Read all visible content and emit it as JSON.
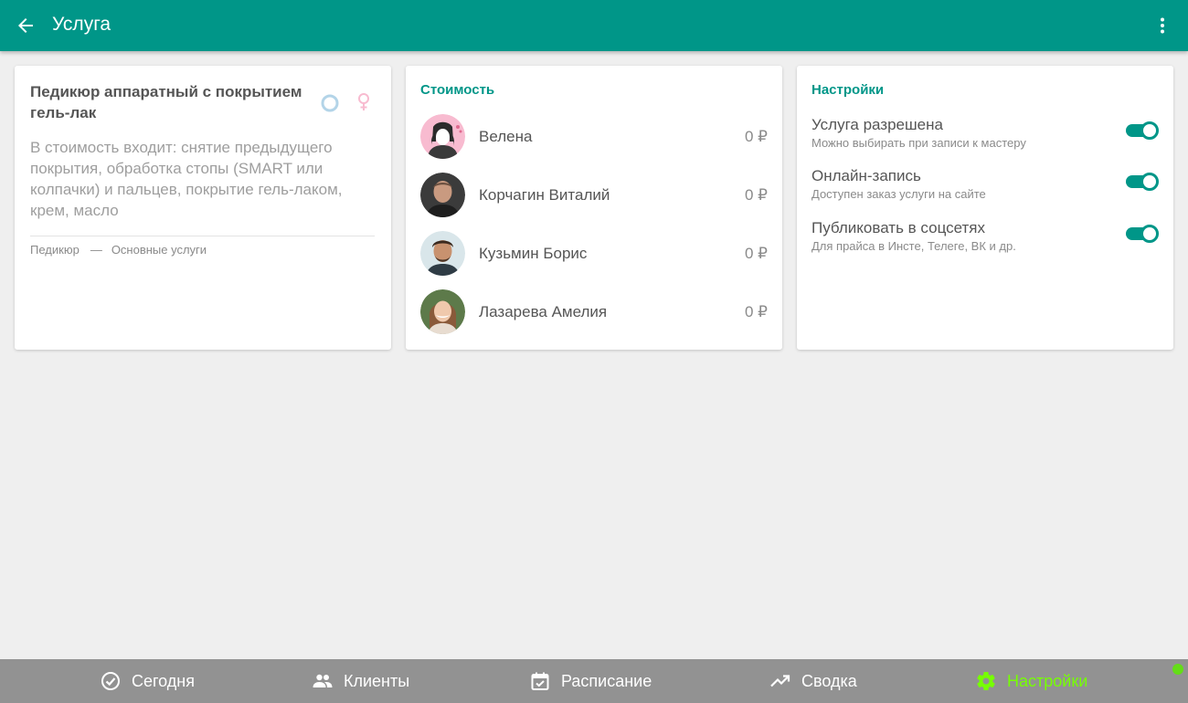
{
  "appbar": {
    "title": "Услуга",
    "back_icon": "arrow-left-icon",
    "menu_icon": "more-vert-icon",
    "color": "#009688"
  },
  "service": {
    "title": "Педикюр аппаратный с покрытием гель-лак",
    "description": "В стоимость входит: снятие предыдущего покрытия, обработка стопы (SMART или колпачки) и пальцев, покрытие гель-лаком, крем, масло",
    "category": "Педикюр",
    "separator": "—",
    "group": "Основные услуги",
    "icons": [
      "unisex-circle-icon",
      "female-icon"
    ]
  },
  "pricing": {
    "title": "Стоимость",
    "staff": [
      {
        "name": "Велена",
        "price": "0 ₽",
        "avatar": "avatar-placeholder-icon"
      },
      {
        "name": "Корчагин Виталий",
        "price": "0 ₽",
        "avatar": "avatar-photo"
      },
      {
        "name": "Кузьмин Борис",
        "price": "0 ₽",
        "avatar": "avatar-photo"
      },
      {
        "name": "Лазарева Амелия",
        "price": "0 ₽",
        "avatar": "avatar-photo"
      }
    ]
  },
  "settings": {
    "title": "Настройки",
    "items": [
      {
        "label": "Услуга разрешена",
        "sub": "Можно выбирать при записи к мастеру",
        "enabled": true
      },
      {
        "label": "Онлайн-запись",
        "sub": "Доступен заказ услуги на сайте",
        "enabled": true
      },
      {
        "label": "Публиковать в соцсетях",
        "sub": "Для прайса в Инсте, Телеге, ВК и др.",
        "enabled": true
      }
    ]
  },
  "bottom_nav": {
    "items": [
      {
        "label": "Сегодня",
        "icon": "check-circle-icon"
      },
      {
        "label": "Клиенты",
        "icon": "people-icon"
      },
      {
        "label": "Расписание",
        "icon": "calendar-check-icon"
      },
      {
        "label": "Сводка",
        "icon": "trending-up-icon"
      },
      {
        "label": "Настройки",
        "icon": "gear-icon",
        "active": true
      }
    ],
    "active_color": "#76ff03"
  }
}
